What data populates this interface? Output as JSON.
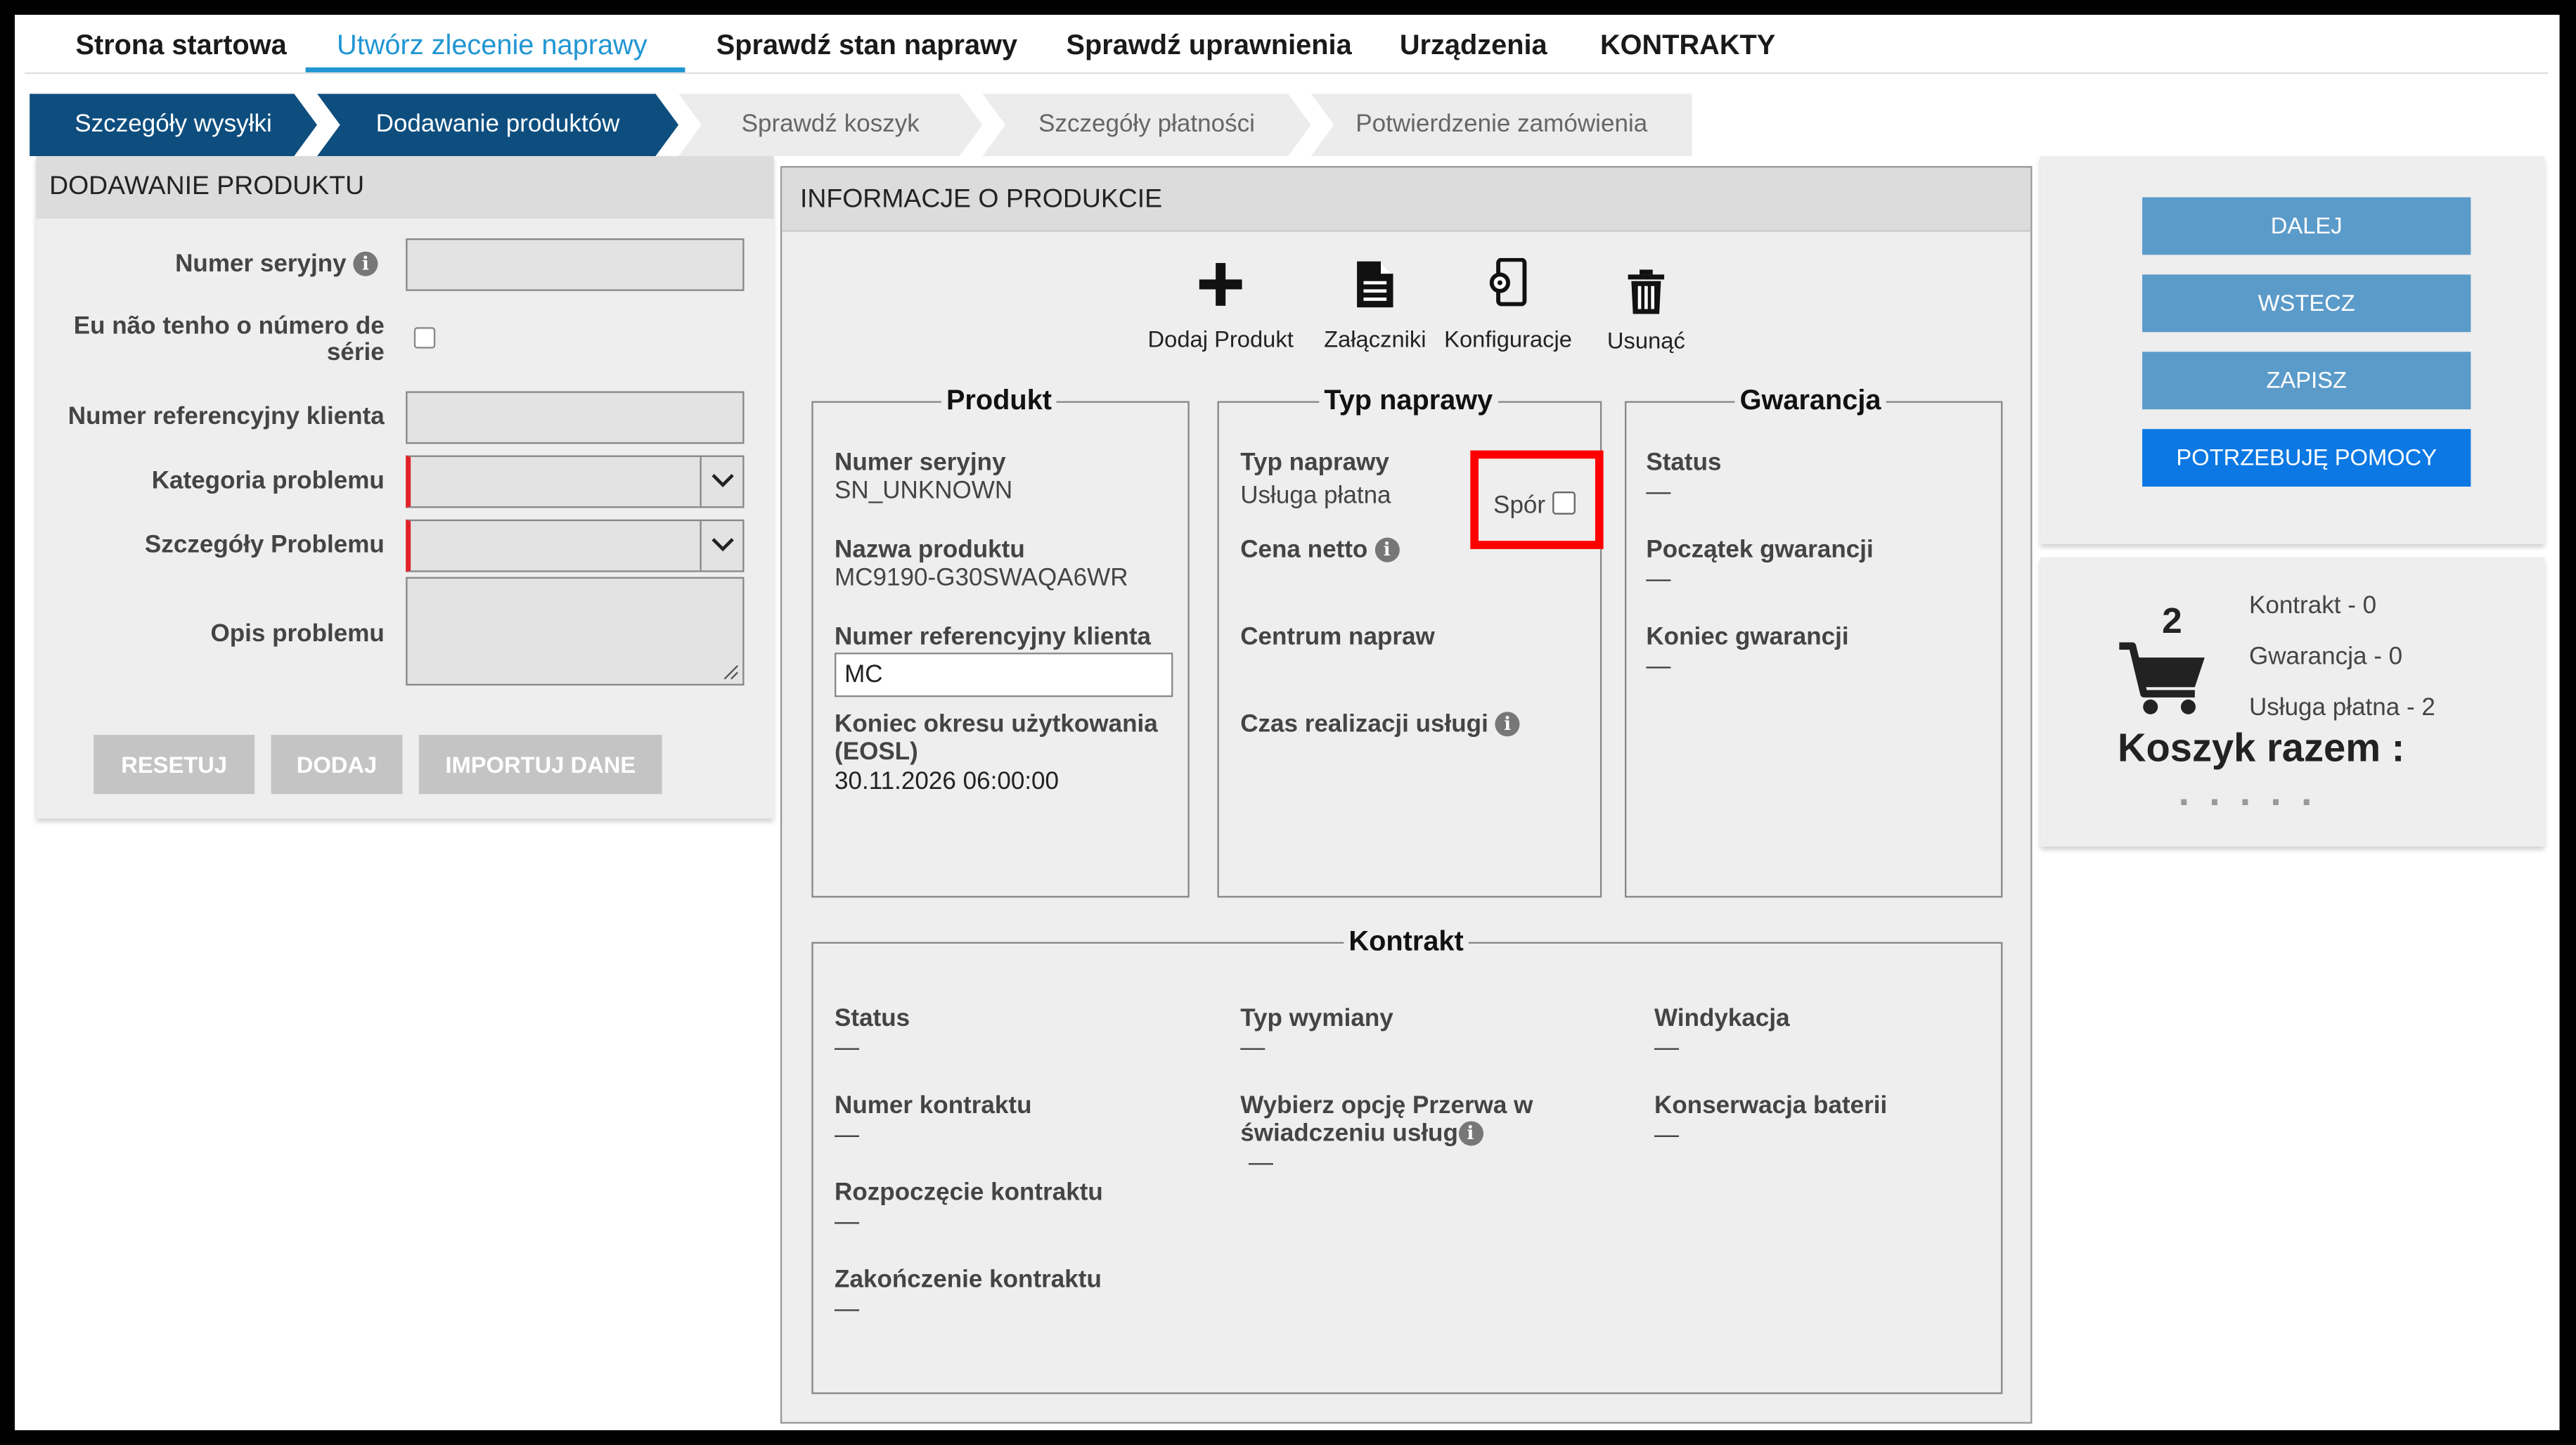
{
  "nav": {
    "items": [
      "Strona startowa",
      "Utwórz zlecenie naprawy",
      "Sprawdź stan naprawy",
      "Sprawdź uprawnienia",
      "Urządzenia",
      "KONTRAKTY"
    ]
  },
  "steps": [
    "Szczegóły wysyłki",
    "Dodawanie produktów",
    "Sprawdź koszyk",
    "Szczegóły płatności",
    "Potwierdzenie zamówienia"
  ],
  "add_product": {
    "title": "DODAWANIE PRODUKTU",
    "serial_label": "Numer seryjny",
    "no_serial_label_1": "Eu não tenho o número de",
    "no_serial_label_2": "série",
    "ref_label": "Numer referencyjny klienta",
    "category_label": "Kategoria problemu",
    "details_label": "Szczegóły Problemu",
    "desc_label": "Opis problemu",
    "reset": "RESETUJ",
    "add": "DODAJ",
    "import": "IMPORTUJ DANE"
  },
  "product_info": {
    "title": "INFORMACJE O PRODUKCIE",
    "toolbar": [
      "Dodaj Produkt",
      "Załączniki",
      "Konfiguracje",
      "Usunąć"
    ],
    "produkt": {
      "legend": "Produkt",
      "serial_label": "Numer seryjny",
      "serial_value": "SN_UNKNOWN",
      "name_label": "Nazwa produktu",
      "name_value": "MC9190-G30SWAQA6WR",
      "ref_label": "Numer referencyjny klienta",
      "ref_value": "MC",
      "eosl_label_1": "Koniec okresu użytkowania",
      "eosl_label_2": "(EOSL)",
      "eosl_value": "30.11.2026 06:00:00"
    },
    "typ": {
      "legend": "Typ naprawy",
      "type_label": "Typ naprawy",
      "type_value": "Usługa płatna",
      "dispute_label": "Spór",
      "price_label": "Cena netto",
      "center_label": "Centrum napraw",
      "time_label": "Czas realizacji usługi"
    },
    "gwarancja": {
      "legend": "Gwarancja",
      "status_label": "Status",
      "status_value": "—",
      "start_label": "Początek gwarancji",
      "start_value": "—",
      "end_label": "Koniec gwarancji",
      "end_value": "—"
    },
    "kontrakt": {
      "legend": "Kontrakt",
      "status_label": "Status",
      "status_value": "—",
      "number_label": "Numer kontraktu",
      "number_value": "—",
      "start_label": "Rozpoczęcie kontraktu",
      "start_value": "—",
      "end_label": "Zakończenie kontraktu",
      "end_value": "—",
      "exchange_label": "Typ wymiany",
      "exchange_value": "—",
      "break_label_1": "Wybierz opcję Przerwa w",
      "break_label_2": "świadczeniu usług",
      "break_value": "—",
      "recovery_label": "Windykacja",
      "recovery_value": "—",
      "battery_label": "Konserwacja baterii",
      "battery_value": "—"
    }
  },
  "actions": {
    "next": "DALEJ",
    "back": "WSTECZ",
    "save": "ZAPISZ",
    "help": "POTRZEBUJĘ POMOCY"
  },
  "cart": {
    "count": "2",
    "contract": "Kontrakt - 0",
    "warranty": "Gwarancja - 0",
    "paid": "Usługa płatna - 2",
    "total_label": "Koszyk razem :"
  },
  "colors": {
    "accent": "#2196d3",
    "step_done": "#0e4e7f",
    "button_blue": "#5b9bc9",
    "help_blue": "#0b78e3",
    "highlight_red": "#ff0000",
    "required_red": "#e2222a"
  }
}
